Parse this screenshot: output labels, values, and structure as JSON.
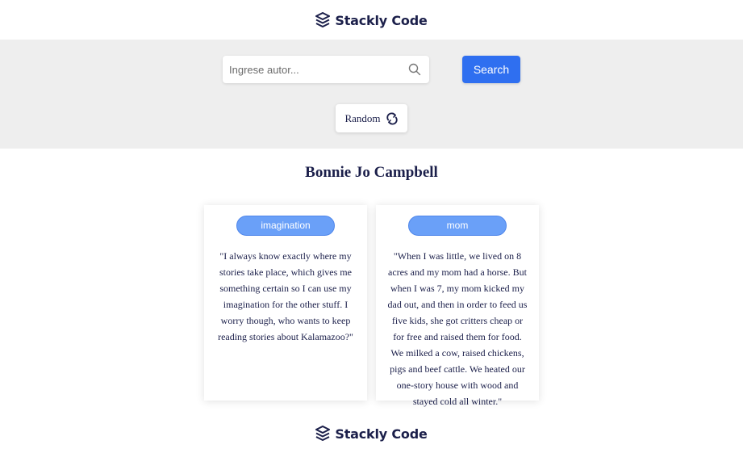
{
  "brand": {
    "name": "Stackly Code",
    "icon": "stack-logo-icon"
  },
  "search": {
    "placeholder": "Ingrese autor...",
    "value": "",
    "button_label": "Search"
  },
  "random": {
    "label": "Random",
    "icon": "refresh-icon"
  },
  "author": {
    "name": "Bonnie Jo Campbell"
  },
  "quotes": [
    {
      "tag": "imagination",
      "text": "\"I always know exactly where my stories take place, which gives me something certain so I can use my imagination for the other stuff. I worry though, who wants to keep reading stories about Kalamazoo?\""
    },
    {
      "tag": "mom",
      "text": "\"When I was little, we lived on 8 acres and my mom had a horse. But when I was 7, my mom kicked my dad out, and then in order to feed us five kids, she got critters cheap or for free and raised them for food. We milked a cow, raised chickens, pigs and beef cattle. We heated our one-story house with wood and stayed cold all winter.\""
    }
  ],
  "footer": {
    "brand_name": "Stackly Code"
  },
  "colors": {
    "accent": "#2f6ff0",
    "tag": "#6aa0f8",
    "band": "#eeeeee",
    "text": "#1b1f4a"
  }
}
